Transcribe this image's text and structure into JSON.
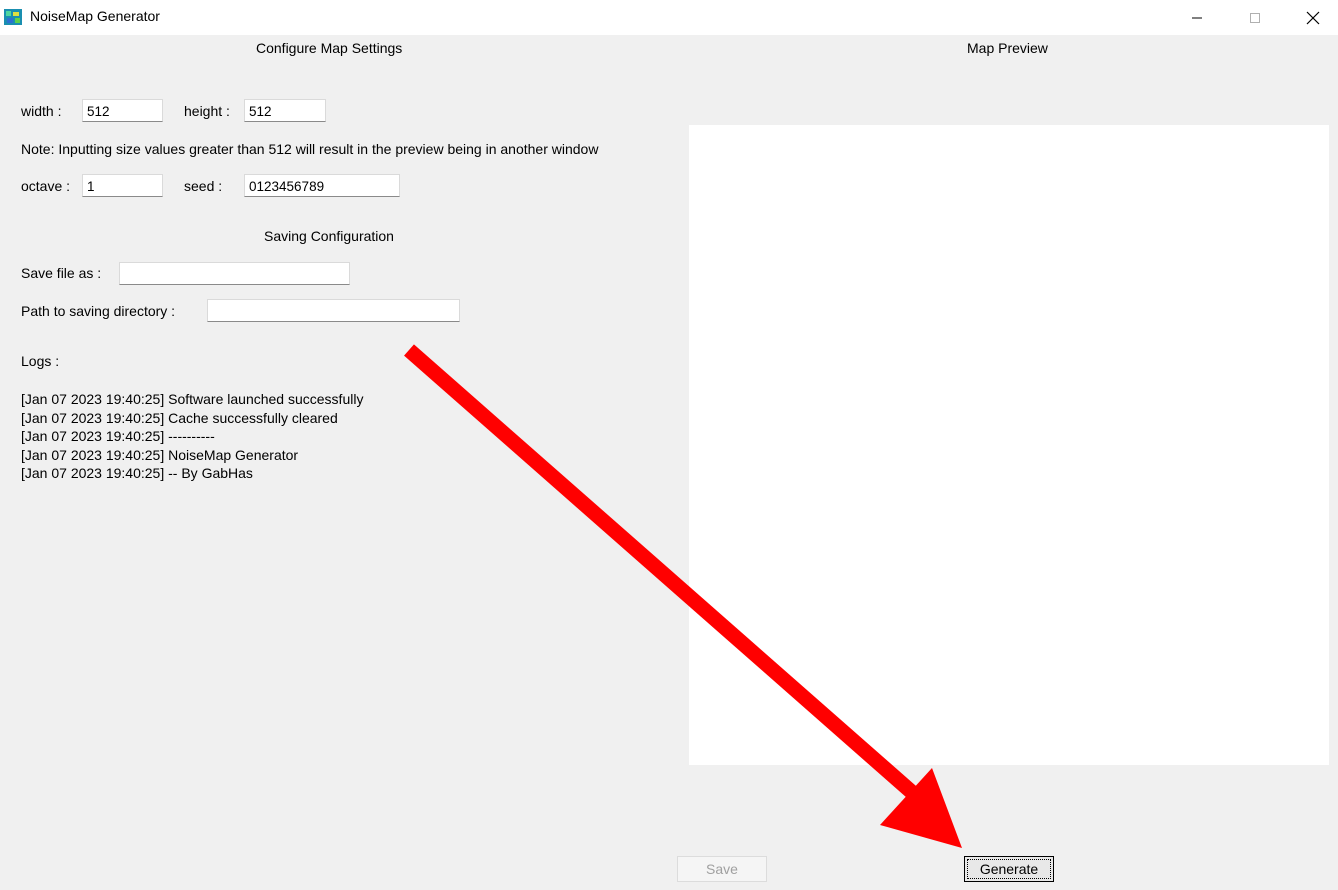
{
  "window": {
    "title": "NoiseMap Generator",
    "icon": "noisemap-app-icon",
    "controls": [
      "minimize-icon",
      "maximize-icon",
      "close-icon"
    ]
  },
  "config": {
    "title": "Configure Map Settings",
    "width_label": "width :",
    "width_value": "512",
    "height_label": "height :",
    "height_value": "512",
    "note": "Note: Inputting size values greater than 512 will result in the preview being in another window",
    "octave_label": "octave :",
    "octave_value": "1",
    "seed_label": "seed :",
    "seed_value": "0123456789"
  },
  "saving": {
    "title": "Saving Configuration",
    "save_file_label": "Save file as :",
    "save_file_value": "",
    "path_label": "Path to saving directory :",
    "path_value": ""
  },
  "logs": {
    "label": "Logs :",
    "lines": [
      "[Jan 07 2023 19:40:25] Software launched successfully",
      "[Jan 07 2023 19:40:25] Cache successfully cleared",
      "[Jan 07 2023 19:40:25] ----------",
      "[Jan 07 2023 19:40:25] NoiseMap Generator",
      "[Jan 07 2023 19:40:25] -- By GabHas"
    ]
  },
  "preview": {
    "title": "Map Preview"
  },
  "buttons": {
    "save_label": "Save",
    "generate_label": "Generate"
  },
  "colors": {
    "window_bg": "#f0f0f0",
    "annotation_arrow": "#ff0000"
  }
}
